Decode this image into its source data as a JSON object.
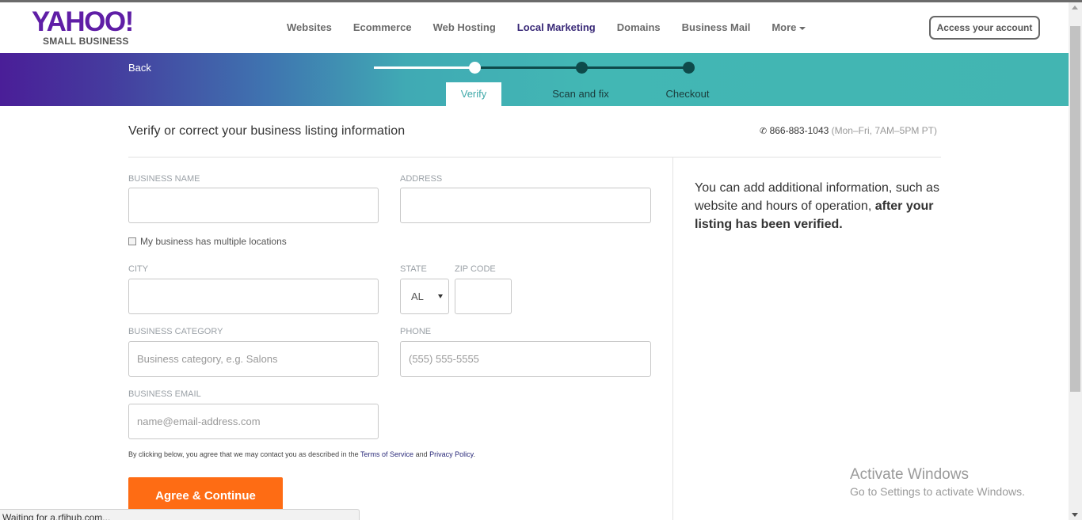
{
  "brand": {
    "logo_main": "YAHOO!",
    "logo_sub": "SMALL BUSINESS",
    "accent_color": "#5f1ea6",
    "cta_color": "#fe6c14",
    "band_color": "#42b5b2"
  },
  "nav": {
    "items": [
      {
        "label": "Websites"
      },
      {
        "label": "Ecommerce"
      },
      {
        "label": "Web Hosting"
      },
      {
        "label": "Local Marketing",
        "active": true
      },
      {
        "label": "Domains"
      },
      {
        "label": "Business Mail"
      },
      {
        "label": "More"
      }
    ],
    "account_button": "Access your account"
  },
  "progress": {
    "back_label": "Back",
    "steps": [
      {
        "label": "Verify",
        "state": "current"
      },
      {
        "label": "Scan and fix",
        "state": "pending"
      },
      {
        "label": "Checkout",
        "state": "pending"
      }
    ]
  },
  "main": {
    "title": "Verify or correct your business listing information",
    "phone": "866-883-1043",
    "phone_hours": "(Mon–Fri, 7AM–5PM PT)",
    "phone_icon": "phone-icon"
  },
  "form": {
    "business_name": {
      "label": "BUSINESS NAME",
      "value": "",
      "placeholder": ""
    },
    "address": {
      "label": "ADDRESS",
      "value": "",
      "placeholder": ""
    },
    "multiple_locations": {
      "label": "My business has multiple locations",
      "checked": false
    },
    "city": {
      "label": "CITY",
      "value": "",
      "placeholder": ""
    },
    "state": {
      "label": "STATE",
      "value": "AL"
    },
    "zip": {
      "label": "ZIP CODE",
      "value": "",
      "placeholder": ""
    },
    "category": {
      "label": "BUSINESS CATEGORY",
      "value": "",
      "placeholder": "Business category, e.g. Salons"
    },
    "phone": {
      "label": "PHONE",
      "value": "",
      "placeholder": "(555) 555-5555"
    },
    "email": {
      "label": "BUSINESS EMAIL",
      "value": "",
      "placeholder": "name@email-address.com"
    },
    "consent_prefix": "By clicking below, you agree that we may contact you as described in the",
    "terms_label": "Terms of Service",
    "consent_and": "and",
    "privacy_label": "Privacy Policy",
    "consent_suffix": ".",
    "submit_label": "Agree & Continue"
  },
  "side_note": {
    "text": "You can add additional information, such as website and hours of operation,",
    "bold": "after your listing has been verified."
  },
  "watermark": {
    "title": "Activate Windows",
    "subtitle": "Go to Settings to activate Windows."
  },
  "status_bar": {
    "text": "Waiting for a.rfihub.com..."
  }
}
